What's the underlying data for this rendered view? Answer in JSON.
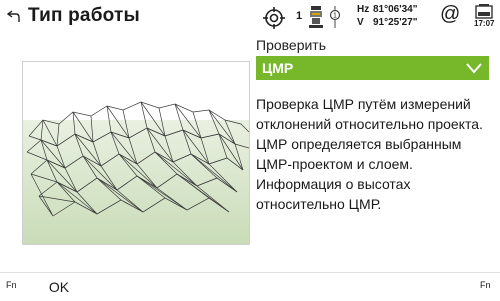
{
  "header": {
    "title": "Тип работы",
    "station_number": "1",
    "hz_label": "Hz",
    "hz_value": "81°06'34\"",
    "v_label": "V",
    "v_value": "91°25'27\"",
    "at_symbol": "@",
    "clock": "17:07",
    "icons": [
      "back-arrow-icon",
      "target-crosshair-icon",
      "total-station-icon",
      "battery-icon"
    ]
  },
  "check": {
    "label": "Проверить",
    "selected": "ЦМР"
  },
  "description": "Проверка ЦМР путём измерений отклонений относительно проекта. ЦМР определяется выбранным ЦМР-проектом и слоем. Информация о высотах относительно ЦМР.",
  "footer": {
    "fn_left": "Fn",
    "ok_label": "OK",
    "fn_right": "Fn"
  },
  "colors": {
    "accent": "#76b82a",
    "terrain_fill": "#dfe9d4"
  }
}
